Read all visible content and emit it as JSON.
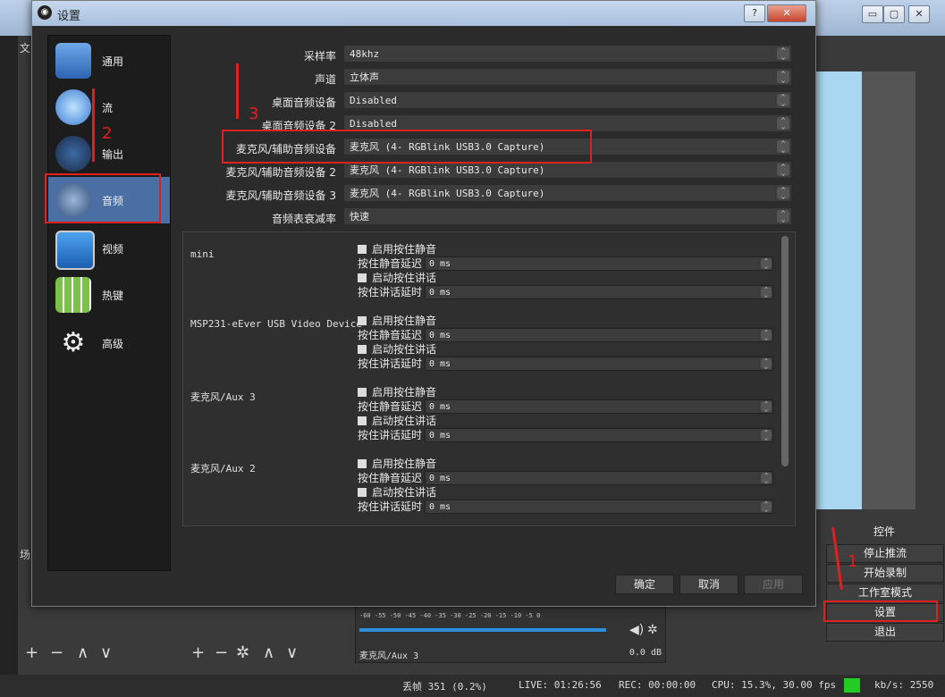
{
  "dialog": {
    "title": "设置"
  },
  "sidebar": {
    "items": [
      {
        "label": "通用",
        "icon": "monitor-icon"
      },
      {
        "label": "流",
        "icon": "globe-icon"
      },
      {
        "label": "输出",
        "icon": "output-icon"
      },
      {
        "label": "音频",
        "icon": "speaker-icon"
      },
      {
        "label": "视频",
        "icon": "display-icon"
      },
      {
        "label": "热键",
        "icon": "keyboard-icon"
      },
      {
        "label": "高级",
        "icon": "gears-icon"
      }
    ]
  },
  "audio": {
    "rows": [
      {
        "label": "采样率",
        "value": "48khz"
      },
      {
        "label": "声道",
        "value": "立体声"
      },
      {
        "label": "桌面音频设备",
        "value": "Disabled"
      },
      {
        "label": "桌面音频设备 2",
        "value": "Disabled"
      },
      {
        "label": "麦克风/辅助音频设备",
        "value": "麦克风 (4- RGBlink USB3.0 Capture)"
      },
      {
        "label": "麦克风/辅助音频设备 2",
        "value": "麦克风 (4- RGBlink USB3.0 Capture)"
      },
      {
        "label": "麦克风/辅助音频设备 3",
        "value": "麦克风 (4- RGBlink USB3.0 Capture)"
      },
      {
        "label": "音频表衰减率",
        "value": "快速"
      }
    ],
    "devices": [
      {
        "name": "mini"
      },
      {
        "name": "MSP231-eEver USB Video Device"
      },
      {
        "name": "麦克风/Aux 3"
      },
      {
        "name": "麦克风/Aux 2"
      }
    ],
    "ptm_label": "启用按住静音",
    "ptm_delay_label": "按住静音延迟",
    "ptt_label": "启动按住讲话",
    "ptt_delay_label": "按住讲话延时",
    "delay_value": "0 ms"
  },
  "buttons": {
    "ok": "确定",
    "cancel": "取消",
    "apply": "应用"
  },
  "annotations": {
    "n1": "1",
    "n2": "2",
    "n3": "3"
  },
  "controls": {
    "title": "控件",
    "items": [
      "停止推流",
      "开始录制",
      "工作室模式",
      "设置",
      "退出"
    ]
  },
  "mixer": {
    "channel": "麦克风/Aux 3",
    "level": "0.0 dB",
    "ticks": "-60 -55 -50 -45 -40 -35 -30 -25 -20 -15 -10 -5 0"
  },
  "status": {
    "dropped": "丢帧 351 (0.2%)",
    "live": "LIVE: 01:26:56",
    "rec": "REC: 00:00:00",
    "cpu": "CPU: 15.3%, 30.00 fps",
    "kbs": "kb/s: 2550"
  },
  "window": {
    "menu_file": "文",
    "scenes": "场"
  },
  "colors": {
    "accent": "#e02020",
    "selected": "#4a6fa5",
    "status_ok": "#22cc22"
  }
}
